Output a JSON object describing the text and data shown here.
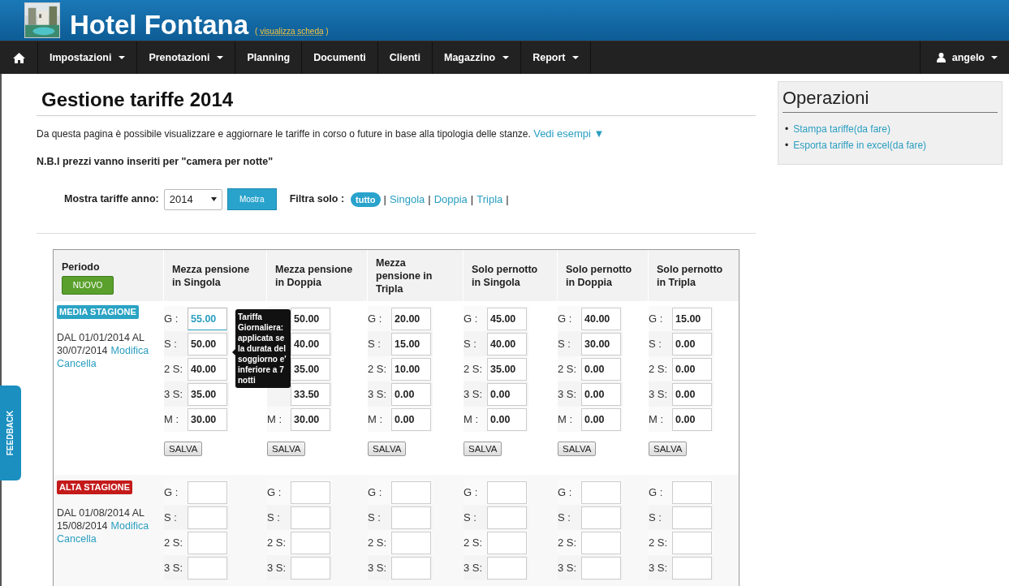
{
  "header": {
    "hotel_name": "Hotel Fontana",
    "link_open": "(",
    "link": "visualizza scheda",
    "link_close": ")"
  },
  "nav": {
    "items": [
      {
        "label": "Impostazioni",
        "dropdown": true
      },
      {
        "label": "Prenotazioni",
        "dropdown": true
      },
      {
        "label": "Planning",
        "dropdown": false
      },
      {
        "label": "Documenti",
        "dropdown": false
      },
      {
        "label": "Clienti",
        "dropdown": false
      },
      {
        "label": "Magazzino",
        "dropdown": true
      },
      {
        "label": "Report",
        "dropdown": true
      }
    ],
    "user": {
      "label": "angelo",
      "dropdown": true
    }
  },
  "page": {
    "title": "Gestione tariffe 2014",
    "intro": "Da questa pagina è possibile visualizzare e aggiornare le tariffe in corso o future in base alla tipologia delle stanze.",
    "examples_link": "Vedi esempi ▼",
    "note": "N.B.I prezzi vanno inseriti per \"camera per notte\"",
    "year_label": "Mostra tariffe anno:",
    "year_value": "2014",
    "show_button": "Mostra",
    "filter_label": "Filtra solo :",
    "filters": [
      {
        "label": "tutto",
        "selected": true,
        "separator": "|"
      },
      {
        "label": "Singola",
        "selected": false,
        "separator": "|"
      },
      {
        "label": "Doppia",
        "selected": false,
        "separator": "|"
      },
      {
        "label": "Tripla",
        "selected": false,
        "separator": "|"
      }
    ]
  },
  "table": {
    "period_header": "Periodo",
    "new_button": "NUOVO",
    "columns": [
      "Mezza pensione in Singola",
      "Mezza pensione in Doppia",
      "Mezza pensione in Tripla",
      "Solo pernotto in Singola",
      "Solo pernotto in Doppia",
      "Solo pernotto in Tripla"
    ],
    "seasons": [
      {
        "name": "MEDIA STAGIONE",
        "color": "#2aa3c4",
        "date_from": "DAL 01/01/2014 AL",
        "date_to": "30/07/2014",
        "edit": "Modifica",
        "delete": "Cancella",
        "save_buttons": [
          "SALVA",
          "SALVA",
          "SALVA",
          "SALVA",
          "SALVA",
          "SALVA"
        ],
        "fields": [
          [
            {
              "label": "G :",
              "value": "55.00",
              "focused": true
            },
            {
              "label": "S :",
              "value": "50.00",
              "focused": false
            },
            {
              "label": "2 S:",
              "value": "40.00",
              "focused": false
            },
            {
              "label": "3 S:",
              "value": "35.00",
              "focused": false
            },
            {
              "label": "M :",
              "value": "30.00",
              "focused": false
            }
          ],
          [
            {
              "value": "50.00",
              "focused": false
            },
            {
              "value": "40.00",
              "focused": false
            },
            {
              "value": "35.00",
              "focused": false
            },
            {
              "value": "33.50",
              "focused": false
            },
            {
              "label": "M :",
              "value": "30.00",
              "focused": false
            }
          ],
          [
            {
              "label": "G :",
              "value": "20.00",
              "focused": false
            },
            {
              "label": "S :",
              "value": "15.00",
              "focused": false
            },
            {
              "label": "2 S:",
              "value": "10.00",
              "focused": false
            },
            {
              "label": "3 S:",
              "value": "0.00",
              "focused": false
            },
            {
              "label": "M :",
              "value": "0.00",
              "focused": false
            }
          ],
          [
            {
              "label": "G :",
              "value": "45.00",
              "focused": false
            },
            {
              "label": "S :",
              "value": "40.00",
              "focused": false
            },
            {
              "label": "2 S:",
              "value": "35.00",
              "focused": false
            },
            {
              "label": "3 S:",
              "value": "0.00",
              "focused": false
            },
            {
              "label": "M :",
              "value": "0.00",
              "focused": false
            }
          ],
          [
            {
              "label": "G :",
              "value": "40.00",
              "focused": false
            },
            {
              "label": "S :",
              "value": "30.00",
              "focused": false
            },
            {
              "label": "2 S:",
              "value": "0.00",
              "focused": false
            },
            {
              "label": "3 S:",
              "value": "0.00",
              "focused": false
            },
            {
              "label": "M :",
              "value": "0.00",
              "focused": false
            }
          ],
          [
            {
              "label": "G :",
              "value": "15.00",
              "focused": false
            },
            {
              "label": "S :",
              "value": "0.00",
              "focused": false
            },
            {
              "label": "2 S:",
              "value": "0.00",
              "focused": false
            },
            {
              "label": "3 S:",
              "value": "0.00",
              "focused": false
            },
            {
              "label": "M :",
              "value": "0.00",
              "focused": false
            }
          ]
        ],
        "tooltip": "Tariffa Giornaliera: applicata se la durata del soggiorno e' inferiore a 7 notti"
      },
      {
        "name": "ALTA STAGIONE",
        "color": "#c41a1a",
        "date_from": "DAL 01/08/2014 AL",
        "date_to": "15/08/2014",
        "edit": "Modifica",
        "delete": "Cancella",
        "fields": [
          [
            {
              "label": "G :"
            },
            {
              "label": "S :"
            },
            {
              "label": "2 S:"
            },
            {
              "label": "3 S:"
            }
          ],
          [
            {
              "label": "G :"
            },
            {
              "label": "S :"
            },
            {
              "label": "2 S:"
            },
            {
              "label": "3 S:"
            }
          ],
          [
            {
              "label": "G :"
            },
            {
              "label": "S :"
            },
            {
              "label": "2 S:"
            },
            {
              "label": "3 S:"
            }
          ],
          [
            {
              "label": "G :"
            },
            {
              "label": "S :"
            },
            {
              "label": "2 S:"
            },
            {
              "label": "3 S:"
            }
          ],
          [
            {
              "label": "G :"
            },
            {
              "label": "S :"
            },
            {
              "label": "2 S:"
            },
            {
              "label": "3 S:"
            }
          ],
          [
            {
              "label": "G :"
            },
            {
              "label": "S :"
            },
            {
              "label": "2 S:"
            },
            {
              "label": "3 S:"
            }
          ]
        ]
      }
    ]
  },
  "sidebar": {
    "title": "Operazioni",
    "links": [
      {
        "bullet": "•",
        "label": "Stampa tariffe(da fare)"
      },
      {
        "bullet": "•",
        "label": "Esporta tariffe in excel(da fare)"
      }
    ]
  },
  "feedback_tab": "FEEDBACK"
}
